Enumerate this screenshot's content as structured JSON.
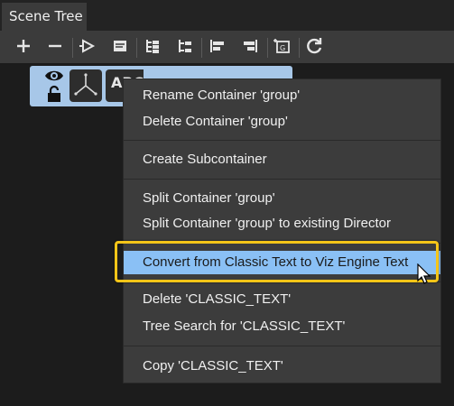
{
  "tab": {
    "title": "Scene Tree"
  },
  "toolbar": {
    "buttons": [
      {
        "name": "add-icon"
      },
      {
        "name": "remove-icon"
      },
      {
        "name": "play-icon"
      },
      {
        "name": "document-icon"
      },
      {
        "name": "tree-expand-icon"
      },
      {
        "name": "tree-collapse-icon"
      },
      {
        "name": "align-left-icon"
      },
      {
        "name": "align-right-icon"
      },
      {
        "name": "group-icon"
      },
      {
        "name": "refresh-icon"
      }
    ]
  },
  "node": {
    "text_glyph": "ABC"
  },
  "menu": {
    "rename": "Rename Container 'group'",
    "delete_container": "Delete Container 'group'",
    "create_sub": "Create Subcontainer",
    "split": "Split Container 'group'",
    "split_director": "Split Container 'group' to existing Director",
    "convert": "Convert from Classic Text to Viz Engine Text",
    "delete_text": "Delete 'CLASSIC_TEXT'",
    "tree_search": "Tree Search for 'CLASSIC_TEXT'",
    "copy": "Copy 'CLASSIC_TEXT'"
  },
  "colors": {
    "highlight": "#8ac0f5",
    "focus_frame": "#f5c518",
    "node_selected": "#a7c7e8"
  }
}
